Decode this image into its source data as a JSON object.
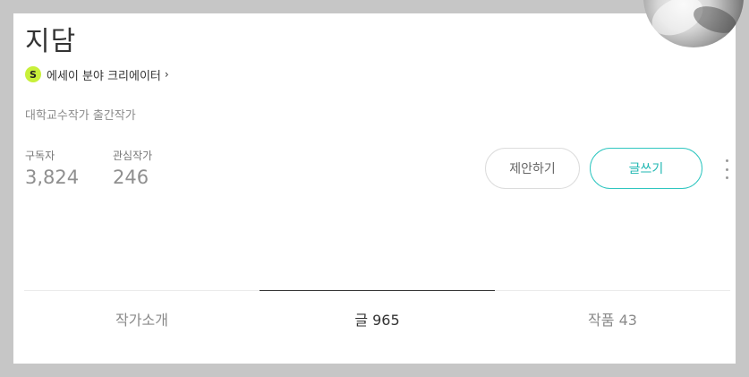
{
  "profile": {
    "name": "지담",
    "creator_badge": "S",
    "creator_label": "에세이 분야 크리에이터",
    "creator_chevron": "›",
    "description": "대학교수작가 출간작가"
  },
  "stats": {
    "subscribers_label": "구독자",
    "subscribers_value": "3,824",
    "following_label": "관심작가",
    "following_value": "246"
  },
  "actions": {
    "propose_label": "제안하기",
    "write_label": "글쓰기",
    "more_icon": "vertical-ellipsis"
  },
  "tabs": [
    {
      "label": "작가소개",
      "active": false
    },
    {
      "label": "글 965",
      "active": true
    },
    {
      "label": "작품 43",
      "active": false
    }
  ],
  "colors": {
    "badge": "#c8f03a",
    "accent": "#1fb7b2",
    "background": "#c6c6c6"
  }
}
